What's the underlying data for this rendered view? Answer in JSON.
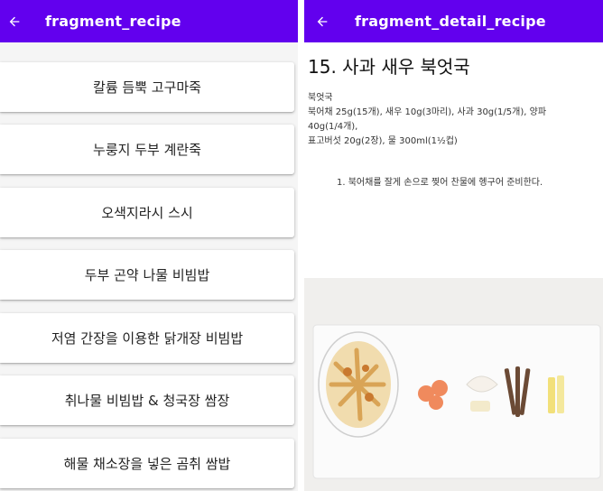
{
  "list_screen": {
    "title": "fragment_recipe",
    "back_icon": "arrow-back-icon",
    "recipes": [
      "칼륨 듬뿍 고구마죽",
      "누룽지 두부 계란죽",
      "오색지라시 스시",
      "두부 곤약 나물 비빔밥",
      "저염 간장을 이용한 닭개장 비빔밥",
      "취나물 비빔밥 & 청국장 쌈장",
      "해물 채소장을 넣은 곰취 쌈밥"
    ]
  },
  "detail_screen": {
    "title": "fragment_detail_recipe",
    "back_icon": "arrow-back-icon",
    "recipe_title": "15. 사과 새우 북엇국",
    "ingredients_heading": "북엇국",
    "ingredients_lines": [
      "북어채 25g(15개), 새우 10g(3마리), 사과 30g(1/5개), 양파",
      "40g(1/4개),",
      "표고버섯 20g(2장), 물 300ml(1½컵)"
    ],
    "step_1": "1. 북어채를 잘게 손으로 찢어 찬물에 헹구어 준비한다."
  },
  "colors": {
    "app_bar": "#6200ee",
    "list_background": "#f5f5f5",
    "card_background": "#ffffff"
  }
}
